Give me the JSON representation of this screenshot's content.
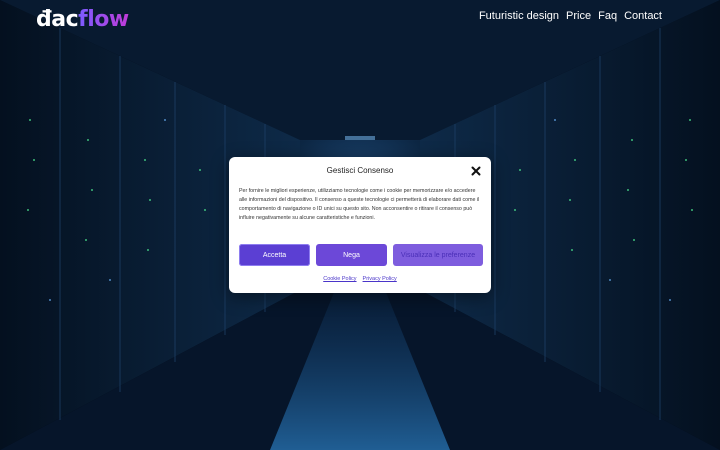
{
  "brand": {
    "part1": "đac",
    "part2": "flow"
  },
  "nav": {
    "items": [
      {
        "label": "Futuristic design"
      },
      {
        "label": "Price"
      },
      {
        "label": "Faq"
      },
      {
        "label": "Contact"
      }
    ]
  },
  "consent": {
    "title": "Gestisci Consenso",
    "body": "Per fornire le migliori esperienze, utilizziamo tecnologie come i cookie per memorizzare e/o accedere alle informazioni del dispositivo. Il consenso a queste tecnologie ci permetterà di elaborare dati come il comportamento di navigazione o ID unici su questo sito. Non acconsentire o ritirare il consenso può influire negativamente su alcune caratteristiche e funzioni.",
    "accept_label": "Accetta",
    "deny_label": "Nega",
    "prefs_label": "Visualizza le preferenze",
    "cookie_policy_label": "Cookie Policy",
    "privacy_policy_label": "Privacy Policy"
  },
  "colors": {
    "accent": "#5b3fd3",
    "brand_gradient_start": "#7b5cff",
    "brand_gradient_end": "#c13bd8",
    "background": "#020812"
  },
  "icons": {
    "close": "close-icon"
  }
}
